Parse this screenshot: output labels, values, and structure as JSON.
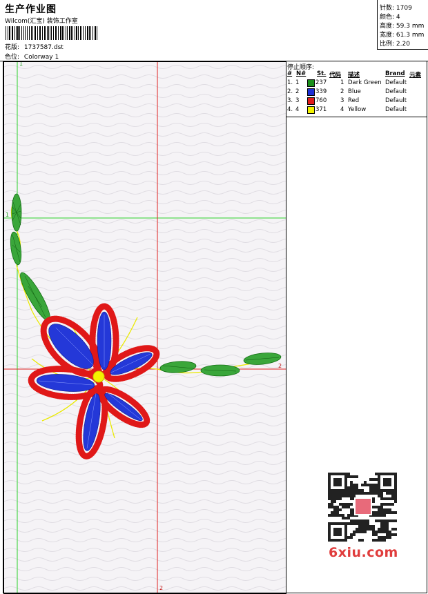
{
  "header": {
    "title": "生产作业图",
    "company": "Wilcom(汇宝) 装饰工作室",
    "design_label": "花版:",
    "design_file": "1737587.dst",
    "colorway_label": "色位:",
    "colorway_name": "Colorway 1"
  },
  "stats": [
    {
      "label": "针数:",
      "value": "1709"
    },
    {
      "label": "颜色:",
      "value": "4"
    },
    {
      "label": "高度:",
      "value": "59.3 mm"
    },
    {
      "label": "宽度:",
      "value": "61.3 mm"
    },
    {
      "label": "比例:",
      "value": "2.20"
    }
  ],
  "stop_sequence": {
    "title": "停止顺序:",
    "headers": {
      "hash": "#",
      "no": "N#",
      "st": "St.",
      "code": "代码",
      "desc": "描述",
      "brand": "Brand",
      "elem": "元素"
    },
    "rows": [
      {
        "idx": "1.",
        "no": "1",
        "color": "#1a8f1a",
        "st": "237",
        "code": "1",
        "desc": "Dark Green",
        "brand": "Default"
      },
      {
        "idx": "2.",
        "no": "2",
        "color": "#1c2fd6",
        "st": "339",
        "code": "2",
        "desc": "Blue",
        "brand": "Default"
      },
      {
        "idx": "3.",
        "no": "3",
        "color": "#e11b1b",
        "st": "760",
        "code": "3",
        "desc": "Red",
        "brand": "Default"
      },
      {
        "idx": "4.",
        "no": "4",
        "color": "#f2f200",
        "st": "371",
        "code": "4",
        "desc": "Yellow",
        "brand": "Default"
      }
    ]
  },
  "axes": {
    "green_v_label": "1",
    "green_h_label": "1",
    "red_h_label": "2",
    "red_v_label": "2"
  },
  "watermark": "6xiu.com",
  "colors": {
    "green_guide": "#2bd12b",
    "red_guide": "#e02020",
    "canvas_bg": "#f5f3f6"
  }
}
